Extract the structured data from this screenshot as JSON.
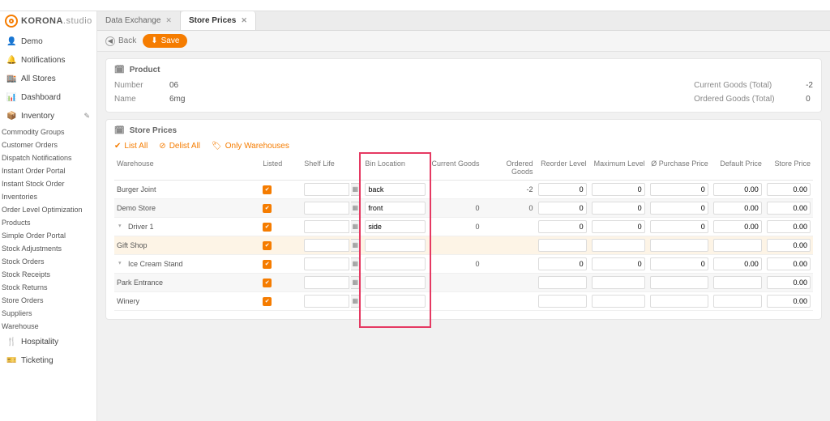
{
  "brand": {
    "name_a": "KORONA",
    "name_b": ".studio"
  },
  "sidebar": {
    "items": [
      {
        "icon": "👤",
        "label": "Demo"
      },
      {
        "icon": "🔔",
        "label": "Notifications"
      },
      {
        "icon": "🏬",
        "label": "All Stores"
      },
      {
        "icon": "📊",
        "label": "Dashboard"
      },
      {
        "icon": "📦",
        "label": "Inventory",
        "edit": true
      }
    ],
    "sub": [
      "Commodity Groups",
      "Customer Orders",
      "Dispatch Notifications",
      "Instant Order Portal",
      "Instant Stock Order",
      "Inventories",
      "Order Level Optimization",
      "Products",
      "Simple Order Portal",
      "Stock Adjustments",
      "Stock Orders",
      "Stock Receipts",
      "Stock Returns",
      "Store Orders",
      "Suppliers",
      "Warehouse"
    ],
    "tail": [
      {
        "icon": "🍴",
        "label": "Hospitality"
      },
      {
        "icon": "🎫",
        "label": "Ticketing"
      }
    ]
  },
  "tabs": [
    {
      "label": "Data Exchange",
      "active": false
    },
    {
      "label": "Store Prices",
      "active": true
    }
  ],
  "toolbar": {
    "back": "Back",
    "save": "Save"
  },
  "product": {
    "title": "Product",
    "number_k": "Number",
    "number_v": "06",
    "name_k": "Name",
    "name_v": "6mg",
    "cg_k": "Current Goods (Total)",
    "cg_v": "-2",
    "og_k": "Ordered Goods (Total)",
    "og_v": "0"
  },
  "store_prices": {
    "title": "Store Prices",
    "filters": {
      "list_all": "List All",
      "delist_all": "Delist All",
      "only_wh": "Only Warehouses"
    },
    "cols": [
      "Warehouse",
      "Listed",
      "Shelf Life",
      "Bin Location",
      "Current Goods",
      "Ordered Goods",
      "Reorder Level",
      "Maximum Level",
      "Ø Purchase Price",
      "Default Price",
      "Store Price"
    ],
    "rows": [
      {
        "wh": "Burger Joint",
        "listed": true,
        "bin": "back",
        "cg": "",
        "og": "-2",
        "rl": "0",
        "ml": "0",
        "pp": "0",
        "dp": "0.00",
        "sp": "0.00"
      },
      {
        "wh": "Demo Store",
        "listed": true,
        "bin": "front",
        "cg": "0",
        "og": "0",
        "rl": "0",
        "ml": "0",
        "pp": "0",
        "dp": "0.00",
        "sp": "0.00",
        "alt": true
      },
      {
        "wh": "Driver 1",
        "listed": true,
        "bin": "side",
        "cg": "0",
        "og": "",
        "rl": "0",
        "ml": "0",
        "pp": "0",
        "dp": "0.00",
        "sp": "0.00",
        "indent": true
      },
      {
        "wh": "Gift Shop",
        "listed": true,
        "bin": "",
        "cg": "",
        "og": "",
        "rl": "",
        "ml": "",
        "pp": "",
        "dp": "",
        "sp": "0.00",
        "sel": true
      },
      {
        "wh": "Ice Cream Stand",
        "listed": true,
        "bin": "",
        "cg": "0",
        "og": "",
        "rl": "0",
        "ml": "0",
        "pp": "0",
        "dp": "0.00",
        "sp": "0.00",
        "indent": true
      },
      {
        "wh": "Park Entrance",
        "listed": true,
        "bin": "",
        "cg": "",
        "og": "",
        "rl": "",
        "ml": "",
        "pp": "",
        "dp": "",
        "sp": "0.00",
        "alt": true
      },
      {
        "wh": "Winery",
        "listed": true,
        "bin": "",
        "cg": "",
        "og": "",
        "rl": "",
        "ml": "",
        "pp": "",
        "dp": "",
        "sp": "0.00"
      }
    ]
  }
}
